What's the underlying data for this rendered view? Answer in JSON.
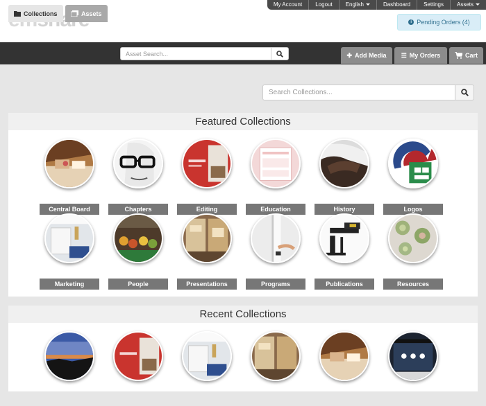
{
  "utility": {
    "items": [
      "My Account",
      "Logout",
      "English",
      "Dashboard",
      "Settings",
      "Assets"
    ]
  },
  "logo": {
    "prefix": "em",
    "suffix": "share"
  },
  "pending": {
    "label": "Pending Orders (4)"
  },
  "nav": {
    "tabs": [
      {
        "label": "Collections",
        "icon": "folder-icon"
      },
      {
        "label": "Assets",
        "icon": "images-icon"
      }
    ],
    "search_placeholder": "Asset Search...",
    "actions": [
      {
        "label": "Add Media",
        "icon": "plus-icon"
      },
      {
        "label": "My Orders",
        "icon": "list-icon"
      },
      {
        "label": "Cart",
        "icon": "cart-icon"
      }
    ]
  },
  "collection_search": {
    "placeholder": "Search Collections..."
  },
  "featured": {
    "title": "Featured Collections",
    "items": [
      "Central Board",
      "Chapters",
      "Editing",
      "Education",
      "History",
      "Logos",
      "Marketing",
      "People",
      "Presentations",
      "Programs",
      "Publications",
      "Resources"
    ]
  },
  "recent": {
    "title": "Recent Collections"
  },
  "colors": {
    "topbar": "#4a4a4a",
    "navbar": "#333333",
    "label_bg": "#777777",
    "info_bg": "#d9edf7"
  }
}
